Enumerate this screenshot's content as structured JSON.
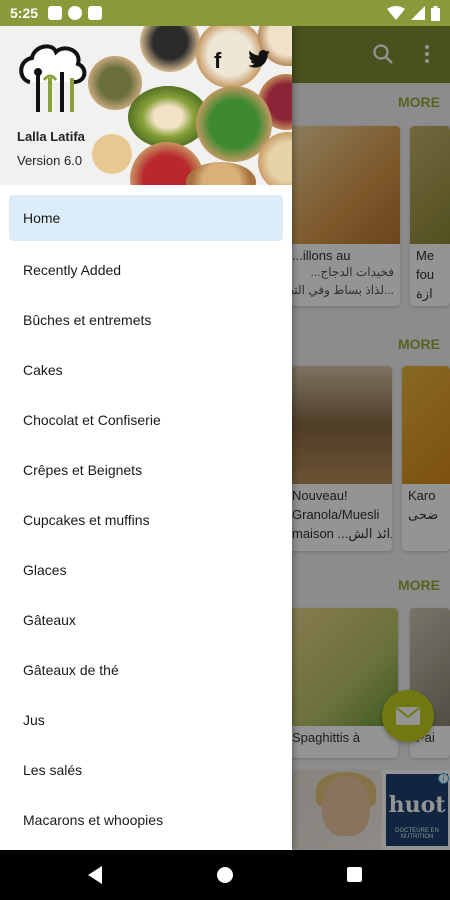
{
  "status_bar": {
    "time": "5:25",
    "icons": [
      "notification-icon",
      "record-icon",
      "storage-icon",
      "wifi-icon",
      "signal-icon",
      "battery-icon"
    ]
  },
  "background": {
    "more_labels": [
      "MORE",
      "MORE",
      "MORE"
    ],
    "cards": [
      {
        "title": "...illons au",
        "arabic_1": "فخيدات الدجاج...",
        "arabic_2": "...لذاذ بساط وفي التت"
      },
      {
        "title": "Me",
        "arabic_1": "fou",
        "arabic_2": "ازة"
      },
      {
        "title": "Nouveau!",
        "arabic_1": "Granola/Muesli",
        "arabic_2": "maison ...لذائذ الش"
      },
      {
        "title": "Karo",
        "arabic_1": "ضحى",
        "arabic_2": ""
      },
      {
        "title": "Spaghittis à",
        "arabic_1": "",
        "arabic_2": ""
      },
      {
        "title": "Pai",
        "arabic_1": "",
        "arabic_2": ""
      }
    ],
    "ad": {
      "brand": "huot",
      "sub": "DOCTEURE EN NUTRITION"
    }
  },
  "drawer": {
    "app_name": "Lalla Latifa",
    "version": "Version 6.0",
    "social": {
      "facebook": "f",
      "twitter": "twitter"
    },
    "menu": [
      {
        "label": "Home",
        "active": true
      },
      {
        "label": "Recently Added"
      },
      {
        "label": "Bûches et entremets"
      },
      {
        "label": "Cakes"
      },
      {
        "label": "Chocolat et Confiserie"
      },
      {
        "label": "Crêpes et Beignets"
      },
      {
        "label": "Cupcakes et muffins"
      },
      {
        "label": "Glaces"
      },
      {
        "label": "Gâteaux"
      },
      {
        "label": "Gâteaux de thé"
      },
      {
        "label": "Jus"
      },
      {
        "label": "Les salés"
      },
      {
        "label": "Macarons et whoopies"
      }
    ]
  },
  "colors": {
    "toolbar": "#7e8e35",
    "status_bar": "#8a9a3b",
    "accent": "#9aa93d",
    "active_item": "#dcedf9",
    "fab": "#c2d11e"
  }
}
